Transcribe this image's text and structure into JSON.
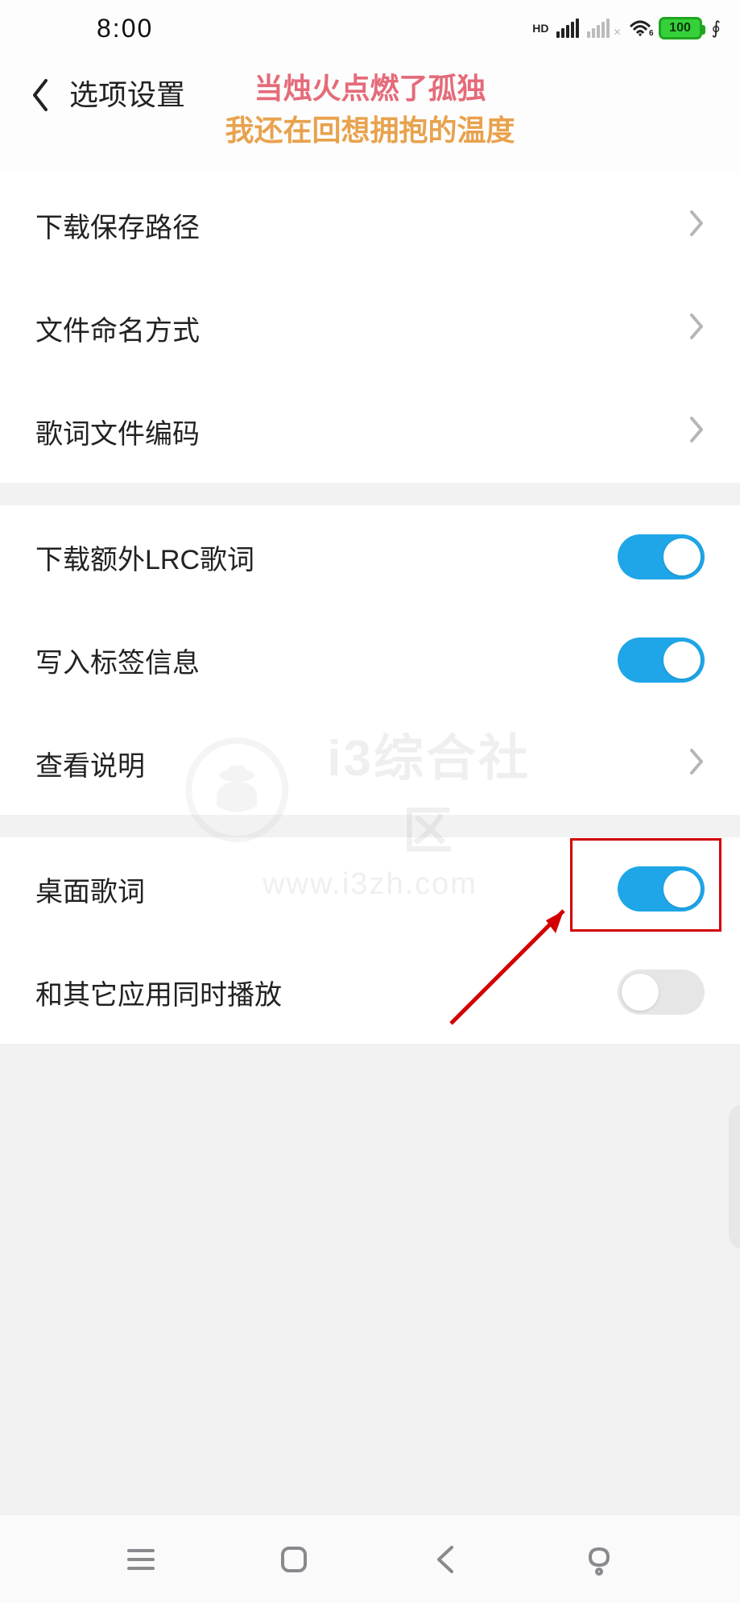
{
  "status": {
    "time": "8:00",
    "hd": "HD",
    "wifi_sub": "6",
    "battery": "100"
  },
  "page": {
    "title": "选项设置"
  },
  "lyric": {
    "line1": "当烛火点燃了孤独",
    "line2": "我还在回想拥抱的温度"
  },
  "section1": {
    "download_path": "下载保存路径",
    "file_naming": "文件命名方式",
    "lyric_encoding": "歌词文件编码"
  },
  "section2": {
    "download_lrc": "下载额外LRC歌词",
    "write_tags": "写入标签信息",
    "view_help": "查看说明"
  },
  "section3": {
    "desktop_lyric": "桌面歌词",
    "play_with_others": "和其它应用同时播放"
  },
  "toggles": {
    "download_lrc": true,
    "write_tags": true,
    "desktop_lyric": true,
    "play_with_others": false
  },
  "watermark": {
    "text": "i3综合社区",
    "url": "www.i3zh.com"
  }
}
